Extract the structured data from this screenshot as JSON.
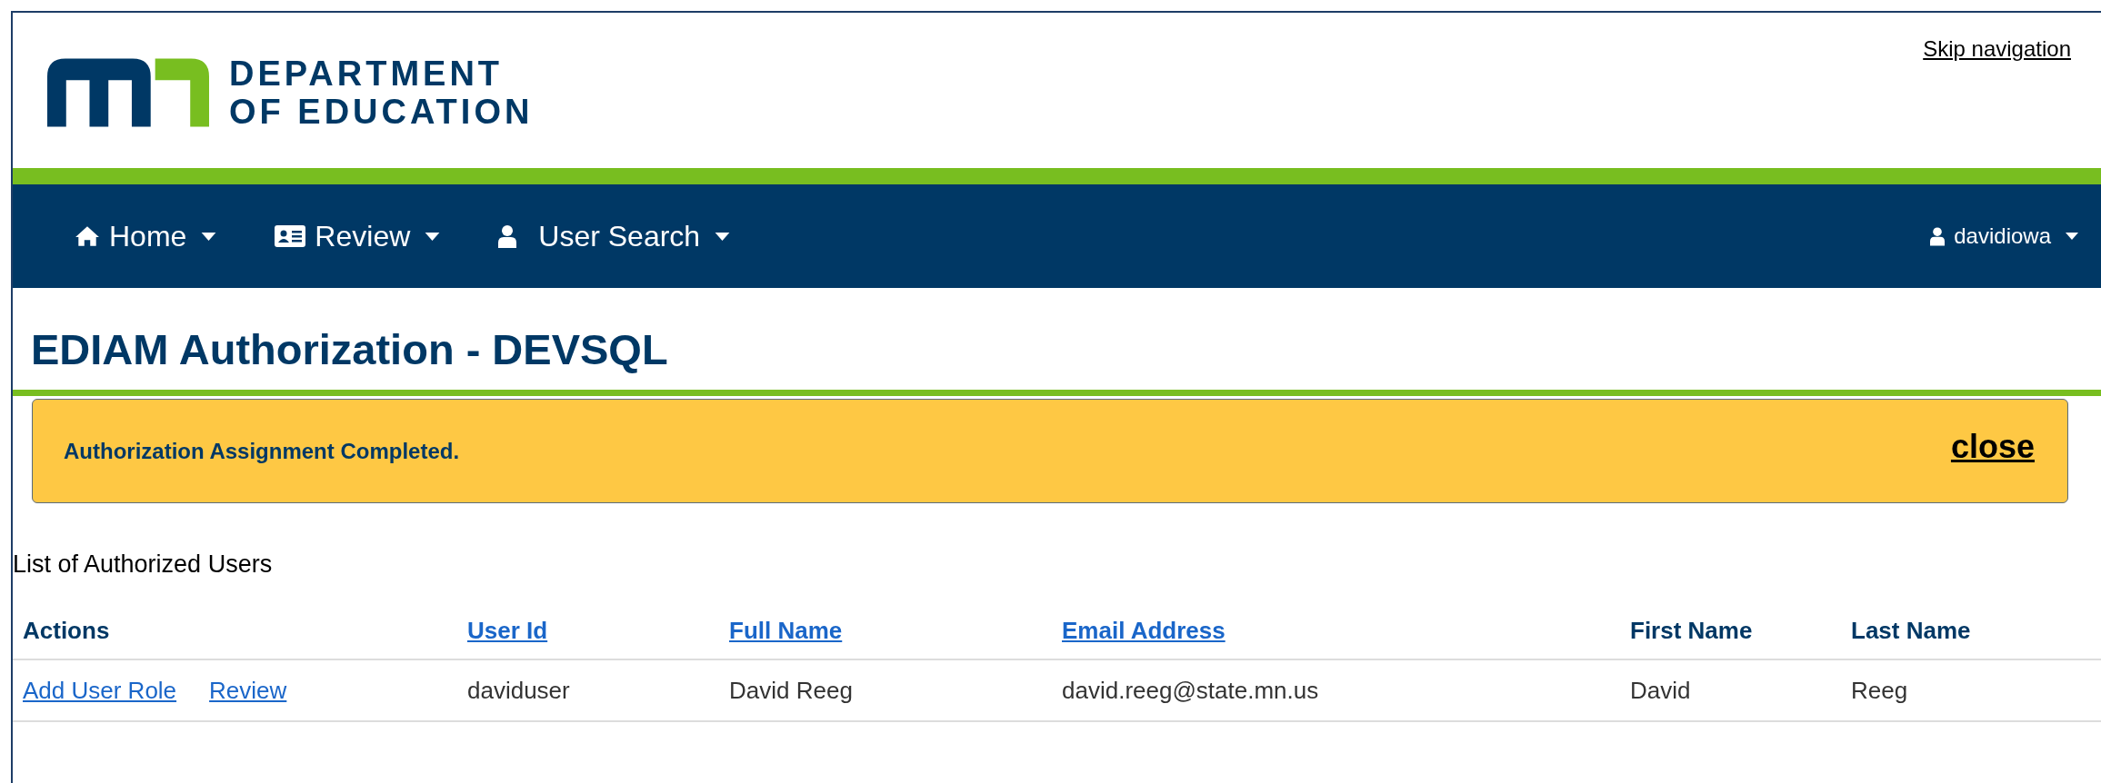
{
  "header": {
    "logo_line_1": "DEPARTMENT",
    "logo_line_2": "OF EDUCATION",
    "skip_link": "Skip navigation"
  },
  "nav": {
    "items": [
      {
        "label": "Home"
      },
      {
        "label": "Review"
      },
      {
        "label": "User Search"
      }
    ],
    "user": {
      "label": "davidiowa"
    }
  },
  "page_title": "EDIAM Authorization - DEVSQL",
  "alert": {
    "message": "Authorization Assignment Completed.",
    "close": "close"
  },
  "table": {
    "caption": "List of Authorized Users",
    "columns": [
      {
        "label": "Actions",
        "sortable": false
      },
      {
        "label": "User Id",
        "sortable": true
      },
      {
        "label": "Full Name",
        "sortable": true
      },
      {
        "label": "Email Address",
        "sortable": true
      },
      {
        "label": "First Name",
        "sortable": false
      },
      {
        "label": "Last Name",
        "sortable": false
      }
    ],
    "rows": [
      {
        "cells": [
          {
            "links": [
              "Add User Role",
              "Review"
            ]
          },
          {
            "text": "daviduser"
          },
          {
            "text": "David Reeg"
          },
          {
            "text": "david.reeg@state.mn.us"
          },
          {
            "text": "David"
          },
          {
            "text": "Reeg"
          }
        ]
      }
    ]
  }
}
